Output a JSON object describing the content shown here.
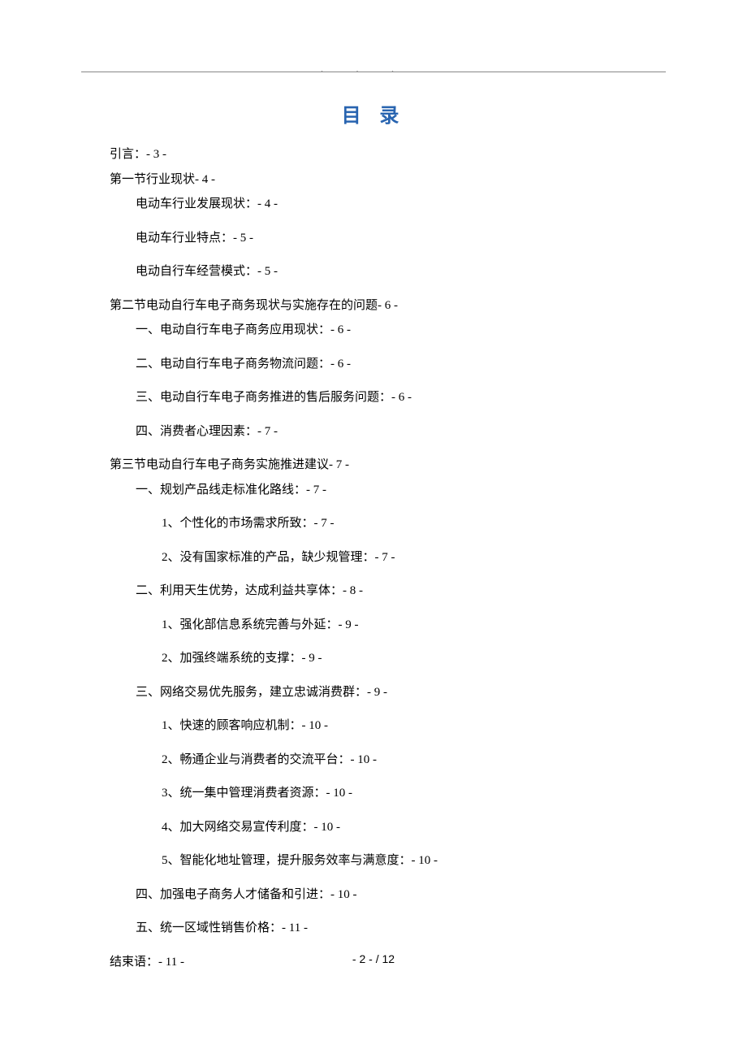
{
  "title": "目 录",
  "entries": [
    {
      "level": 0,
      "text": "引言：- 3 -",
      "spacing": "tight"
    },
    {
      "level": 0,
      "text": "第一节行业现状- 4 -",
      "spacing": "tight"
    },
    {
      "level": 1,
      "text": "电动车行业发展现状：- 4 -",
      "spacing": "spaced"
    },
    {
      "level": 1,
      "text": "电动车行业特点：- 5 -",
      "spacing": "spaced"
    },
    {
      "level": 1,
      "text": "电动自行车经营模式：- 5 -",
      "spacing": "spaced"
    },
    {
      "level": 0,
      "text": "第二节电动自行车电子商务现状与实施存在的问题- 6 -",
      "spacing": "tight"
    },
    {
      "level": 1,
      "text": "一、电动自行车电子商务应用现状：- 6 -",
      "spacing": "spaced"
    },
    {
      "level": 1,
      "text": "二、电动自行车电子商务物流问题：- 6 -",
      "spacing": "spaced"
    },
    {
      "level": 1,
      "text": "三、电动自行车电子商务推进的售后服务问题：- 6 -",
      "spacing": "spaced"
    },
    {
      "level": 1,
      "text": "四、消费者心理因素：- 7 -",
      "spacing": "spaced"
    },
    {
      "level": 0,
      "text": "第三节电动自行车电子商务实施推进建议- 7 -",
      "spacing": "tight"
    },
    {
      "level": 1,
      "text": "一、规划产品线走标准化路线：- 7 -",
      "spacing": "spaced"
    },
    {
      "level": 2,
      "text": "1、个性化的市场需求所致：- 7 -",
      "spacing": "spaced"
    },
    {
      "level": 2,
      "text": "2、没有国家标准的产品，缺少规管理：- 7 -",
      "spacing": "spaced"
    },
    {
      "level": 1,
      "text": "二、利用天生优势，达成利益共享体：- 8 -",
      "spacing": "spaced"
    },
    {
      "level": 2,
      "text": "1、强化部信息系统完善与外延：- 9 -",
      "spacing": "spaced"
    },
    {
      "level": 2,
      "text": "2、加强终端系统的支撑：- 9 -",
      "spacing": "spaced"
    },
    {
      "level": 1,
      "text": "三、网络交易优先服务，建立忠诚消费群：- 9 -",
      "spacing": "spaced"
    },
    {
      "level": 2,
      "text": "1、快速的顾客响应机制：- 10 -",
      "spacing": "spaced"
    },
    {
      "level": 2,
      "text": "2、畅通企业与消费者的交流平台：- 10 -",
      "spacing": "spaced"
    },
    {
      "level": 2,
      "text": "3、统一集中管理消费者资源：- 10 -",
      "spacing": "spaced"
    },
    {
      "level": 2,
      "text": "4、加大网络交易宣传利度：- 10 -",
      "spacing": "spaced"
    },
    {
      "level": 2,
      "text": "5、智能化地址管理，提升服务效率与满意度：- 10 -",
      "spacing": "spaced"
    },
    {
      "level": 1,
      "text": "四、加强电子商务人才储备和引进：- 10 -",
      "spacing": "spaced"
    },
    {
      "level": 1,
      "text": "五、统一区域性销售价格：- 11 -",
      "spacing": "spaced"
    },
    {
      "level": 0,
      "text": "结束语：- 11 -",
      "spacing": "tight"
    }
  ],
  "footer": "- 2 -  / 12"
}
